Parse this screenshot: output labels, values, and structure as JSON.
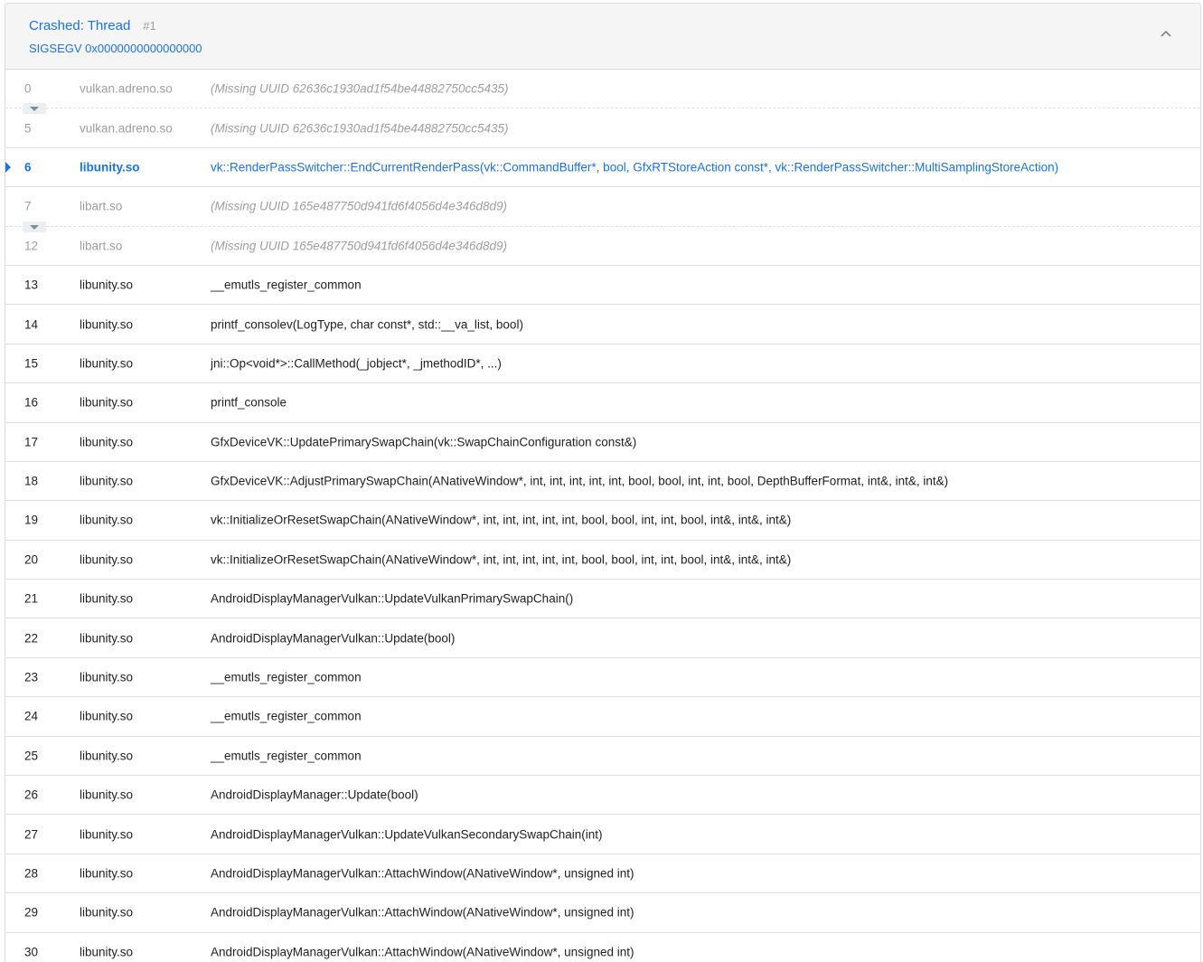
{
  "header": {
    "title": "Crashed: Thread",
    "thread_number": "#1",
    "signal": "SIGSEGV 0x0000000000000000"
  },
  "frames": [
    {
      "num": "0",
      "lib": "vulkan.adreno.so",
      "sym": "(Missing UUID 62636c1930ad1f54be44882750cc5435)",
      "style": "missing",
      "expander": true
    },
    {
      "num": "5",
      "lib": "vulkan.adreno.so",
      "sym": "(Missing UUID 62636c1930ad1f54be44882750cc5435)",
      "style": "missing"
    },
    {
      "num": "6",
      "lib": "libunity.so",
      "sym": "vk::RenderPassSwitcher::EndCurrentRenderPass(vk::CommandBuffer*, bool, GfxRTStoreAction const*, vk::RenderPassSwitcher::MultiSamplingStoreAction)",
      "style": "highlight"
    },
    {
      "num": "7",
      "lib": "libart.so",
      "sym": "(Missing UUID 165e487750d941fd6f4056d4e346d8d9)",
      "style": "missing",
      "expander": true
    },
    {
      "num": "12",
      "lib": "libart.so",
      "sym": "(Missing UUID 165e487750d941fd6f4056d4e346d8d9)",
      "style": "missing"
    },
    {
      "num": "13",
      "lib": "libunity.so",
      "sym": "__emutls_register_common",
      "style": "normal"
    },
    {
      "num": "14",
      "lib": "libunity.so",
      "sym": "printf_consolev(LogType, char const*, std::__va_list, bool)",
      "style": "normal"
    },
    {
      "num": "15",
      "lib": "libunity.so",
      "sym": "jni::Op<void*>::CallMethod(_jobject*, _jmethodID*, ...)",
      "style": "normal"
    },
    {
      "num": "16",
      "lib": "libunity.so",
      "sym": "printf_console",
      "style": "normal"
    },
    {
      "num": "17",
      "lib": "libunity.so",
      "sym": "GfxDeviceVK::UpdatePrimarySwapChain(vk::SwapChainConfiguration const&)",
      "style": "normal"
    },
    {
      "num": "18",
      "lib": "libunity.so",
      "sym": "GfxDeviceVK::AdjustPrimarySwapChain(ANativeWindow*, int, int, int, int, int, bool, bool, int, int, bool, DepthBufferFormat, int&, int&, int&)",
      "style": "normal"
    },
    {
      "num": "19",
      "lib": "libunity.so",
      "sym": "vk::InitializeOrResetSwapChain(ANativeWindow*, int, int, int, int, int, bool, bool, int, int, bool, int&, int&, int&)",
      "style": "normal"
    },
    {
      "num": "20",
      "lib": "libunity.so",
      "sym": "vk::InitializeOrResetSwapChain(ANativeWindow*, int, int, int, int, int, bool, bool, int, int, bool, int&, int&, int&)",
      "style": "normal"
    },
    {
      "num": "21",
      "lib": "libunity.so",
      "sym": "AndroidDisplayManagerVulkan::UpdateVulkanPrimarySwapChain()",
      "style": "normal"
    },
    {
      "num": "22",
      "lib": "libunity.so",
      "sym": "AndroidDisplayManagerVulkan::Update(bool)",
      "style": "normal"
    },
    {
      "num": "23",
      "lib": "libunity.so",
      "sym": "__emutls_register_common",
      "style": "normal"
    },
    {
      "num": "24",
      "lib": "libunity.so",
      "sym": "__emutls_register_common",
      "style": "normal"
    },
    {
      "num": "25",
      "lib": "libunity.so",
      "sym": "__emutls_register_common",
      "style": "normal"
    },
    {
      "num": "26",
      "lib": "libunity.so",
      "sym": "AndroidDisplayManager::Update(bool)",
      "style": "normal"
    },
    {
      "num": "27",
      "lib": "libunity.so",
      "sym": "AndroidDisplayManagerVulkan::UpdateVulkanSecondarySwapChain(int)",
      "style": "normal"
    },
    {
      "num": "28",
      "lib": "libunity.so",
      "sym": "AndroidDisplayManagerVulkan::AttachWindow(ANativeWindow*, unsigned int)",
      "style": "normal"
    },
    {
      "num": "29",
      "lib": "libunity.so",
      "sym": "AndroidDisplayManagerVulkan::AttachWindow(ANativeWindow*, unsigned int)",
      "style": "normal"
    },
    {
      "num": "30",
      "lib": "libunity.so",
      "sym": "AndroidDisplayManagerVulkan::AttachWindow(ANativeWindow*, unsigned int)",
      "style": "normal"
    }
  ],
  "icons": {
    "collapse": "chevron-up-icon",
    "expand": "chevron-down-icon",
    "crash_marker": "crash-pointer-icon"
  },
  "colors": {
    "accent": "#1a73e8",
    "muted": "#9e9e9e",
    "header_bg": "#f5f5f5"
  }
}
